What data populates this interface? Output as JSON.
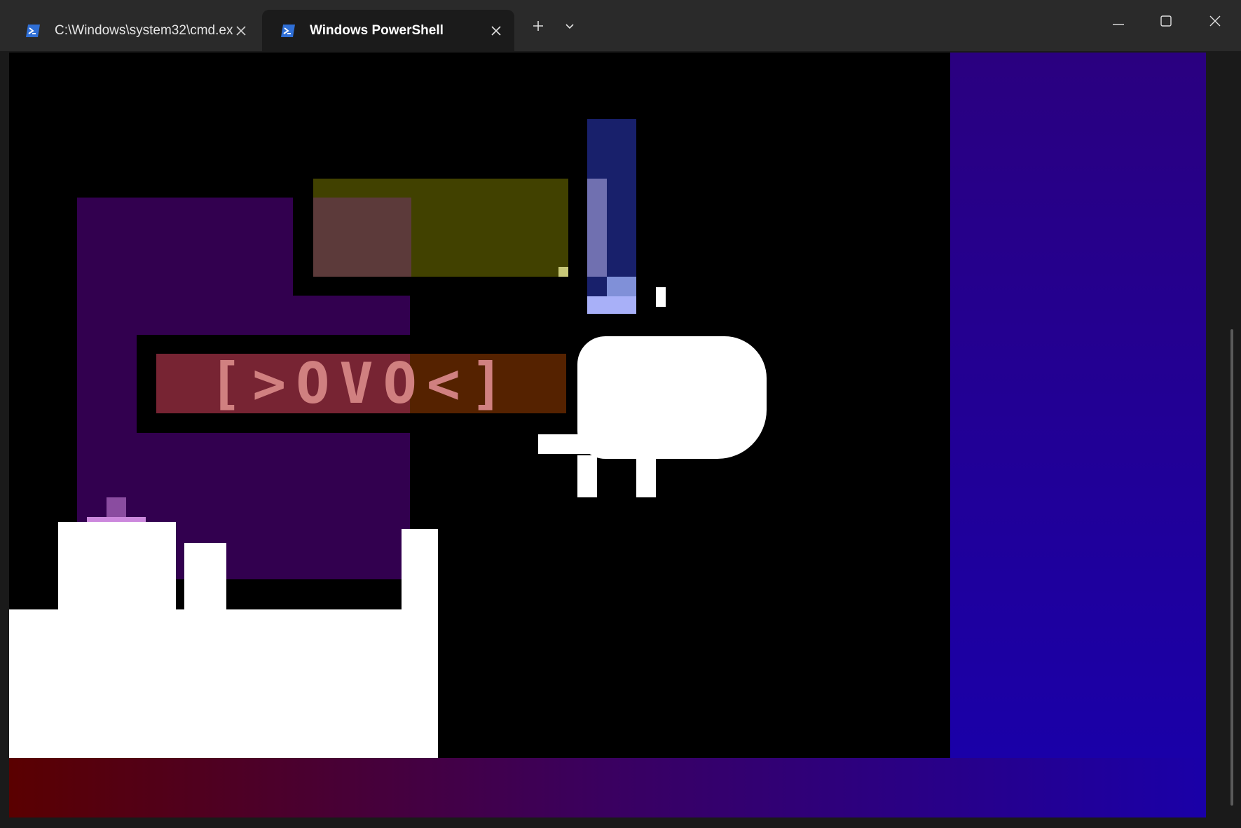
{
  "window": {
    "tabs": [
      {
        "label": "C:\\Windows\\system32\\cmd.ex",
        "icon": "powershell-icon",
        "active": false
      },
      {
        "label": "Windows PowerShell",
        "icon": "powershell-icon",
        "active": true
      }
    ],
    "new_tab_icon": "plus-icon",
    "dropdown_icon": "chevron-down-icon",
    "controls": [
      "minimize-icon",
      "maximize-icon",
      "close-icon"
    ]
  },
  "terminal": {
    "game_text": "[>OVO<]",
    "colors": {
      "background": "#000000",
      "right_panel_top": "#2a0080",
      "right_panel_bottom": "#1a00a8",
      "bottom_strip_left": "#5a0000",
      "bottom_strip_right": "#1a00a8",
      "purple_block": "#32004f",
      "olive_block": "#414100",
      "rose_block": "#5c3a3a",
      "banner_bg": "#772433",
      "banner_text": "#d08080",
      "blue_bar": "#18206b",
      "white_sprite": "#ffffff",
      "pink_flame": "#cc88dd"
    }
  }
}
